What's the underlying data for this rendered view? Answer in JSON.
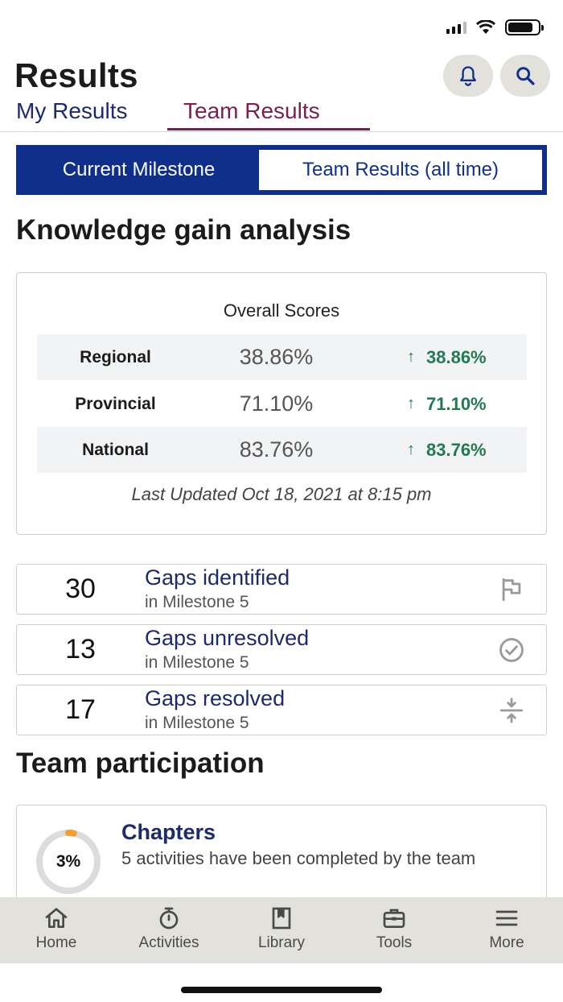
{
  "header": {
    "title": "Results",
    "bell_icon": "bell-icon",
    "search_icon": "search-icon"
  },
  "tabs": [
    {
      "label": "My Results",
      "active": false
    },
    {
      "label": "Team Results",
      "active": true
    }
  ],
  "segment": {
    "active": "Current Milestone",
    "inactive": "Team Results (all time)"
  },
  "knowledge": {
    "title": "Knowledge gain analysis",
    "card_title": "Overall Scores",
    "rows": [
      {
        "name": "Regional",
        "value": "38.86%",
        "delta": "38.86%"
      },
      {
        "name": "Provincial",
        "value": "71.10%",
        "delta": "71.10%"
      },
      {
        "name": "National",
        "value": "83.76%",
        "delta": "83.76%"
      }
    ],
    "last_updated": "Last Updated Oct 18, 2021 at 8:15 pm"
  },
  "gaps": [
    {
      "count": "30",
      "title": "Gaps identified",
      "sub": "in Milestone 5",
      "icon": "flag-icon"
    },
    {
      "count": "13",
      "title": "Gaps unresolved",
      "sub": "in Milestone 5",
      "icon": "check-circle-icon"
    },
    {
      "count": "17",
      "title": "Gaps resolved",
      "sub": "in Milestone 5",
      "icon": "compress-icon"
    }
  ],
  "participation": {
    "title": "Team participation",
    "card": {
      "percent_label": "3%",
      "percent": 3,
      "title": "Chapters",
      "desc": "5 activities have been completed by the team"
    }
  },
  "nav": [
    {
      "label": "Home",
      "icon": "home-icon"
    },
    {
      "label": "Activities",
      "icon": "stopwatch-icon"
    },
    {
      "label": "Library",
      "icon": "book-icon"
    },
    {
      "label": "Tools",
      "icon": "toolbox-icon"
    },
    {
      "label": "More",
      "icon": "menu-icon"
    }
  ],
  "colors": {
    "primary": "#0f2f8a",
    "accent": "#7b1f4e",
    "positive": "#237a52",
    "progress": "#f0a030"
  }
}
